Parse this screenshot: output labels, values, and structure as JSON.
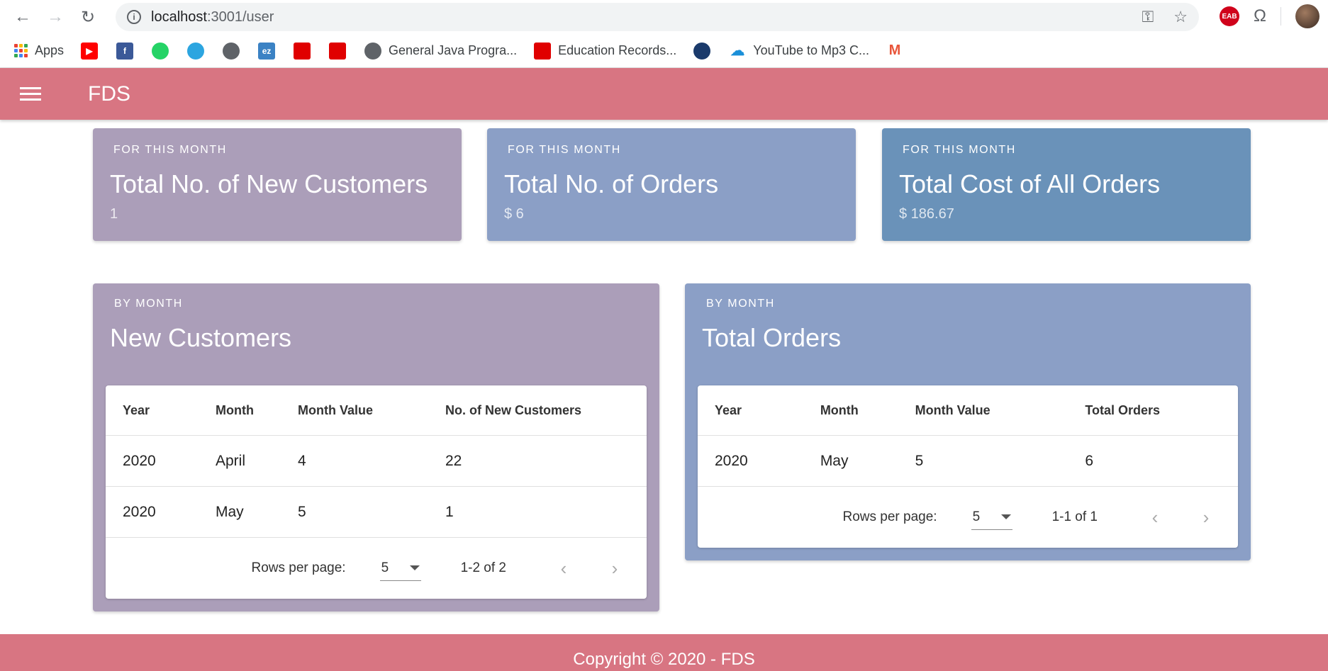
{
  "browser": {
    "url_host": "localhost",
    "url_path": ":3001/user",
    "bookmarks": [
      {
        "label": "Apps",
        "icon": "apps-grid-icon"
      },
      {
        "label": "",
        "icon": "youtube-icon",
        "color": "#ff0000"
      },
      {
        "label": "",
        "icon": "facebook-icon",
        "color": "#3b5998"
      },
      {
        "label": "",
        "icon": "whatsapp-icon",
        "color": "#25d366"
      },
      {
        "label": "",
        "icon": "telegram-icon",
        "color": "#2ca5e0"
      },
      {
        "label": "",
        "icon": "globe-icon",
        "color": "#5f6368"
      },
      {
        "label": "",
        "icon": "ez-icon",
        "color": "#3b82c4"
      },
      {
        "label": "",
        "icon": "oracle-academy-icon",
        "color": "#e00000"
      },
      {
        "label": "",
        "icon": "oracle-icon",
        "color": "#e00000"
      },
      {
        "label": "General Java Progra...",
        "icon": "globe-icon",
        "color": "#5f6368"
      },
      {
        "label": "Education Records...",
        "icon": "oracle-academy-icon",
        "color": "#e00000"
      },
      {
        "label": "",
        "icon": "dots-icon",
        "color": "#1a3a6b"
      },
      {
        "label": "YouTube to Mp3 C...",
        "icon": "cloud-download-icon",
        "color": "#1a8fd8"
      },
      {
        "label": "",
        "icon": "m-shield-icon",
        "color": "#e8553a"
      }
    ]
  },
  "app": {
    "title": "FDS"
  },
  "stats": [
    {
      "overline": "FOR THIS MONTH",
      "title": "Total No. of New Customers",
      "value": "1",
      "color": "#ab9eb9"
    },
    {
      "overline": "FOR THIS MONTH",
      "title": "Total No. of Orders",
      "value": "$ 6",
      "color": "#8b9fc6"
    },
    {
      "overline": "FOR THIS MONTH",
      "title": "Total Cost of All Orders",
      "value": "$ 186.67",
      "color": "#6a92b9"
    }
  ],
  "panels": {
    "customers": {
      "overline": "BY MONTH",
      "title": "New Customers",
      "columns": [
        "Year",
        "Month",
        "Month Value",
        "No. of New Customers"
      ],
      "rows": [
        [
          "2020",
          "April",
          "4",
          "22"
        ],
        [
          "2020",
          "May",
          "5",
          "1"
        ]
      ],
      "rows_per_page_label": "Rows per page:",
      "rows_per_page": "5",
      "range": "1-2 of 2"
    },
    "orders": {
      "overline": "BY MONTH",
      "title": "Total Orders",
      "columns": [
        "Year",
        "Month",
        "Month Value",
        "Total Orders"
      ],
      "rows": [
        [
          "2020",
          "May",
          "5",
          "6"
        ]
      ],
      "rows_per_page_label": "Rows per page:",
      "rows_per_page": "5",
      "range": "1-1 of 1"
    }
  },
  "footer": {
    "text": "Copyright © 2020 - FDS"
  }
}
